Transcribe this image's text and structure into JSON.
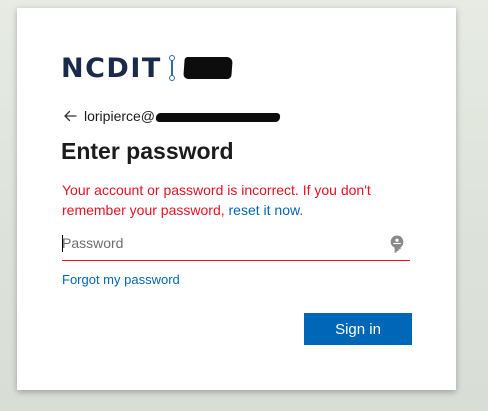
{
  "brand": {
    "logo_text": "NCDIT",
    "mark_icon": "link-icon",
    "redaction_icon": "redacted-scribble-icon"
  },
  "identity": {
    "back_icon": "arrow-left-icon",
    "email_visible": "loripierce@"
  },
  "heading": "Enter password",
  "error": {
    "message": "Your account or password is incorrect. If you don't remember your password,",
    "link_text": "reset it now",
    "trailing": "."
  },
  "password": {
    "placeholder": "Password",
    "value": "",
    "reveal_icon": "key-icon"
  },
  "forgot_link": "Forgot my password",
  "signin_button": "Sign in",
  "colors": {
    "error": "#e81123",
    "link": "#0067b8",
    "button": "#0067b8",
    "brand_navy": "#1b2a4a"
  }
}
